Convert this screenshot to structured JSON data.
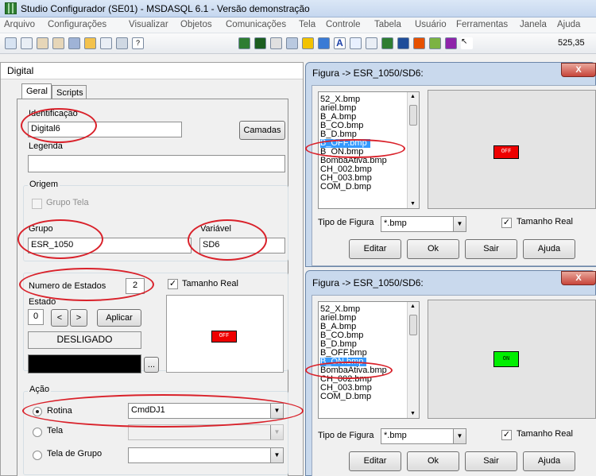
{
  "app": {
    "title": "Studio Configurador (SE01) - MSDASQL 6.1 - Versão demonstração",
    "menu": [
      "Arquivo",
      "Configurações",
      "Visualizar",
      "Objetos",
      "Comunicações",
      "Tela",
      "Controle",
      "Tabela",
      "Usuário",
      "Ferramentas",
      "Janela",
      "Ajuda"
    ],
    "coord": "525,35"
  },
  "digital": {
    "title": "Digital",
    "tabs": [
      "Geral",
      "Scripts"
    ],
    "identificacao_label": "Identificação",
    "identificacao_value": "Digital6",
    "camadas_button": "Camadas",
    "legenda_label": "Legenda",
    "legenda_value": "",
    "origem_title": "Origem",
    "grupo_tela_label": "Grupo Tela",
    "grupo_label": "Grupo",
    "grupo_value": "ESR_1050",
    "variavel_label": "Variável",
    "variavel_value": "SD6",
    "num_estados_label": "Numero de Estados",
    "num_estados_value": "2",
    "tamanho_real_label": "Tamanho Real",
    "estado_label": "Estado",
    "estado_value": "0",
    "prev_button": "<",
    "next_button": ">",
    "aplicar_button": "Aplicar",
    "state_text": "DESLIGADO",
    "ellipsis_button": "...",
    "preview_image_text": "OFF",
    "acao_title": "Ação",
    "rotina_label": "Rotina",
    "rotina_value": "CmdDJ1",
    "tela_label": "Tela",
    "tela_grupo_label": "Tela de Grupo"
  },
  "figura_top": {
    "title": "Figura -> ESR_1050/SD6:",
    "close": "X",
    "files": [
      "52_X.bmp",
      "ariel.bmp",
      "B_A.bmp",
      "B_CO.bmp",
      "B_D.bmp",
      "B_OFF.bmp",
      "B_ON.bmp",
      "BombaAtiva.bmp",
      "CH_002.bmp",
      "CH_003.bmp",
      "COM_D.bmp"
    ],
    "selected": "B_OFF.bmp",
    "preview_text": "OFF",
    "preview_color": "#ee0000",
    "tipo_label": "Tipo de Figura",
    "tipo_value": "*.bmp",
    "tamanho_real_label": "Tamanho Real",
    "buttons": [
      "Editar",
      "Ok",
      "Sair",
      "Ajuda"
    ]
  },
  "figura_bottom": {
    "title": "Figura -> ESR_1050/SD6:",
    "close": "X",
    "files": [
      "52_X.bmp",
      "ariel.bmp",
      "B_A.bmp",
      "B_CO.bmp",
      "B_D.bmp",
      "B_OFF.bmp",
      "B_ON.bmp",
      "BombaAtiva.bmp",
      "CH_002.bmp",
      "CH_003.bmp",
      "COM_D.bmp"
    ],
    "selected": "B_ON.bmp",
    "preview_text": "ON",
    "preview_color": "#00ee00",
    "tipo_label": "Tipo de Figura",
    "tipo_value": "*.bmp",
    "tamanho_real_label": "Tamanho Real",
    "buttons": [
      "Editar",
      "Ok",
      "Sair",
      "Ajuda"
    ]
  }
}
